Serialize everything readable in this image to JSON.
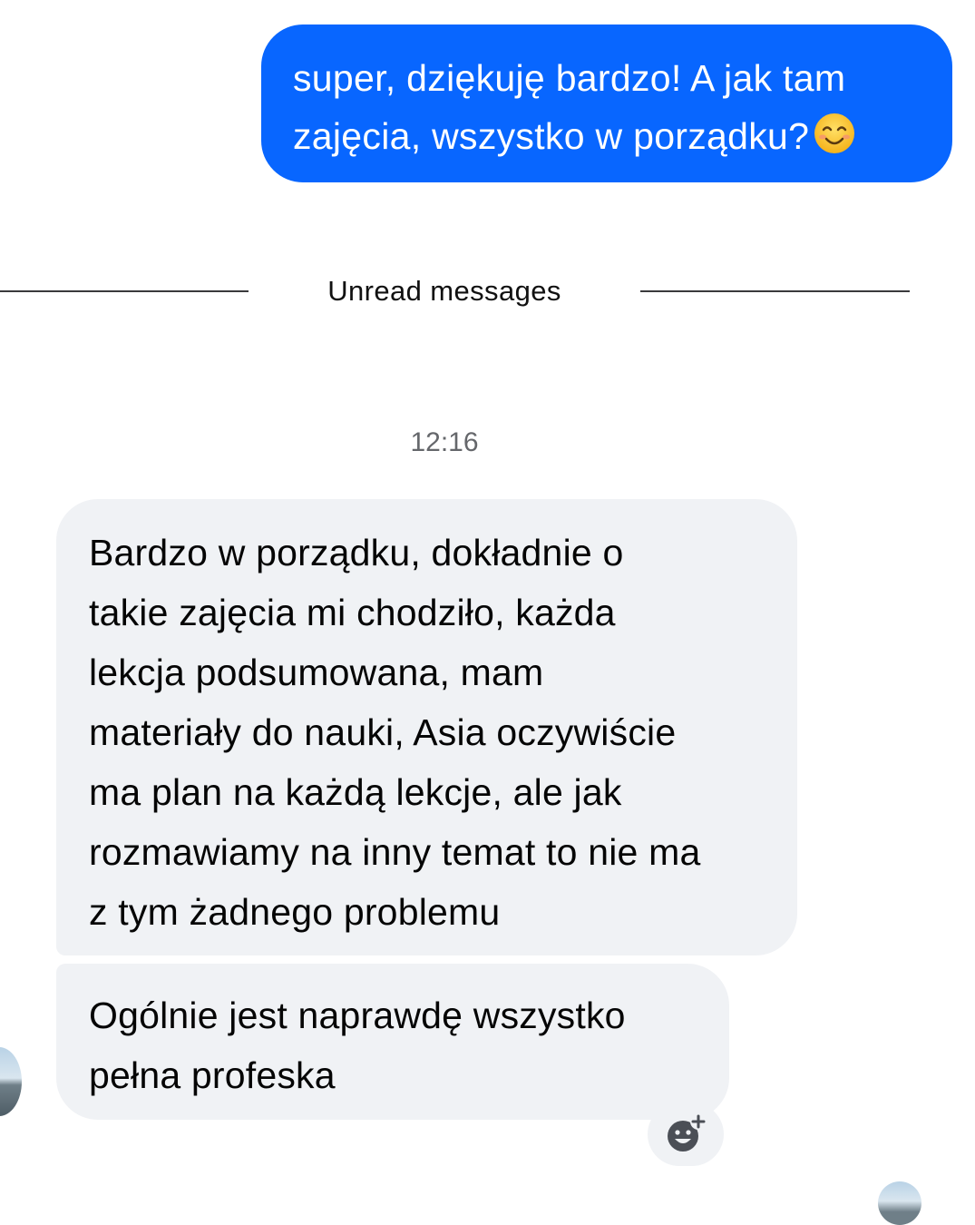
{
  "conversation": {
    "outgoing_message": {
      "lines": [
        "super, dziękuję bardzo! A jak tam",
        "zajęcia, wszystko w porządku?"
      ],
      "emoji": "smiling-face-icon",
      "bubble_color": "#0866ff"
    },
    "unread_divider": {
      "label": "Unread messages"
    },
    "timestamp": "12:16",
    "incoming_messages": [
      {
        "lines": [
          "Bardzo w porządku, dokładnie o",
          "takie zajęcia mi chodziło, każda",
          "lekcja podsumowana, mam",
          "materiały do nauki, Asia oczywiście",
          "ma plan na każdą lekcje, ale jak",
          "rozmawiamy na inny temat to nie ma",
          "z tym żadnego problemu"
        ]
      },
      {
        "lines": [
          "Ogólnie jest naprawdę wszystko",
          "pełna profeska"
        ]
      }
    ],
    "incoming_bubble_color": "#f0f2f5",
    "add_reaction_icon": "add-reaction-icon"
  }
}
